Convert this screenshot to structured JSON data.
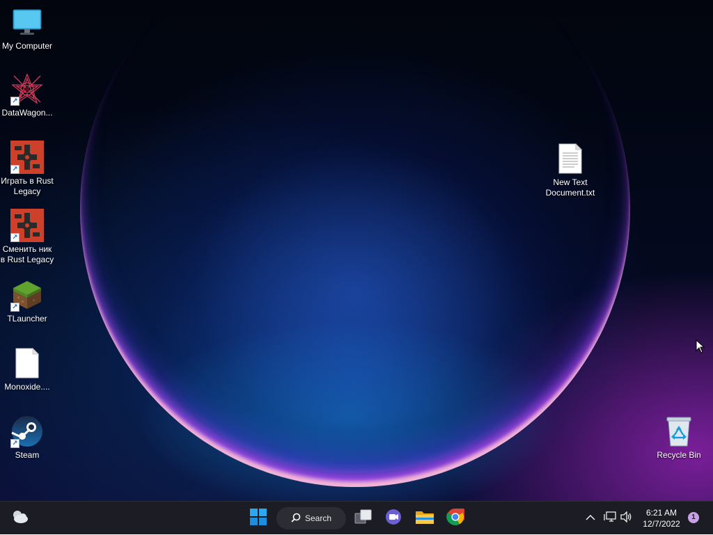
{
  "desktop": {
    "icons": [
      {
        "label": "My Computer",
        "icon": "monitor-icon",
        "shortcut": false
      },
      {
        "label": "DataWagon...",
        "icon": "datawagon-icon",
        "shortcut": true
      },
      {
        "label": "Играть в Rust Legacy",
        "icon": "rust-icon",
        "shortcut": true
      },
      {
        "label": "Сменить ник в Rust Legacy",
        "icon": "rust-icon",
        "shortcut": true
      },
      {
        "label": "TLauncher",
        "icon": "minecraft-grass-icon",
        "shortcut": true
      },
      {
        "label": "Monoxide....",
        "icon": "blank-file-icon",
        "shortcut": false
      },
      {
        "label": "Steam",
        "icon": "steam-icon",
        "shortcut": true
      }
    ],
    "text_file": {
      "label_line1": "New Text",
      "label_line2": "Document.txt",
      "icon": "text-document-icon"
    },
    "recycle_bin": {
      "label": "Recycle Bin",
      "icon": "recycle-bin-icon"
    }
  },
  "taskbar": {
    "widgets_icon": "weather-cloud-icon",
    "start_icon": "windows-logo-icon",
    "search_label": "Search",
    "search_icon": "search-icon",
    "task_view_icon": "task-view-icon",
    "chat_icon": "teams-chat-icon",
    "explorer_icon": "folder-icon",
    "chrome_icon": "chrome-icon",
    "tray": {
      "overflow_icon": "chevron-up-icon",
      "network_icon": "network-icon",
      "volume_icon": "volume-icon"
    },
    "clock": {
      "time": "6:21 AM",
      "date": "12/7/2022"
    },
    "notification_count": "1"
  },
  "colors": {
    "taskbar": "#1c1d24",
    "rust_red": "#cd412b",
    "windows_blue": "#1aa0f0"
  }
}
